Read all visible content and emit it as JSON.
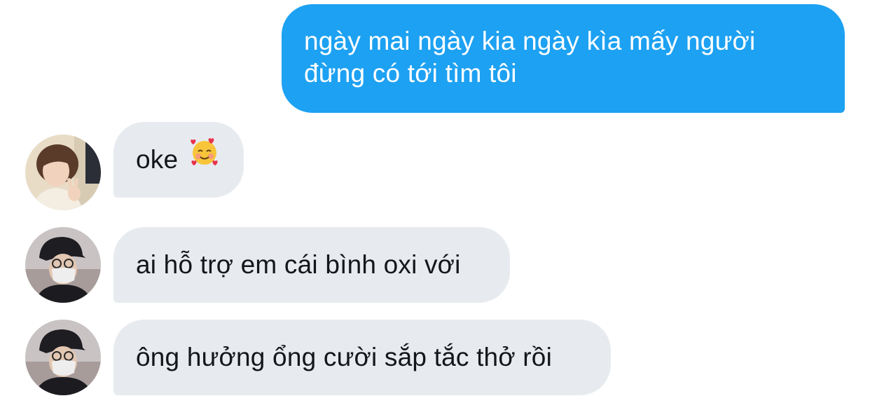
{
  "outgoing_message": {
    "lines": [
      "ngày mai ngày kia ngày kìa mấy người",
      "đừng có tới tìm tôi"
    ],
    "bubble_color": "#1da1f2",
    "text_color": "#ffffff"
  },
  "incoming_messages": [
    {
      "text": "oke",
      "emoji": "smiling-face-with-hearts-emoji",
      "avatar": "avatar-peace-sign"
    },
    {
      "text": "ai hỗ trợ em cái bình oxi với",
      "avatar": "avatar-cap-mask"
    },
    {
      "text": "ông hưởng ổng cười sắp tắc thở rồi",
      "avatar": "avatar-cap-mask"
    }
  ],
  "incoming_bubble_color": "#e7ebef",
  "incoming_text_color": "#14171a"
}
